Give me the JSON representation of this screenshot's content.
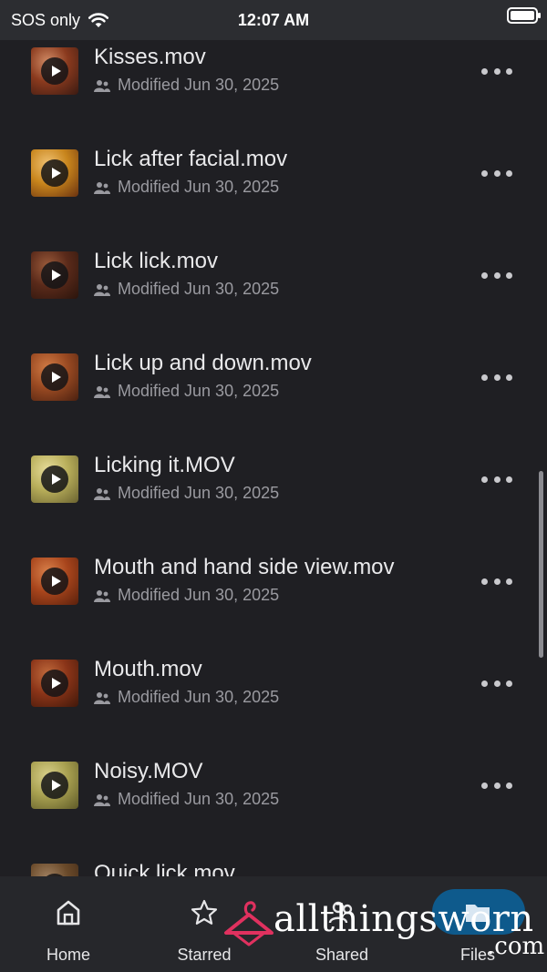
{
  "status_bar": {
    "carrier": "SOS only",
    "time": "12:07 AM",
    "icons": [
      "wifi-icon",
      "battery-icon"
    ]
  },
  "files": [
    {
      "name": "Kisses.mov",
      "modified": "Modified Jun 30, 2025",
      "thumb_colors": [
        "#8a3a1e",
        "#d08a64",
        "#3a1a12"
      ]
    },
    {
      "name": "Lick after facial.mov",
      "modified": "Modified Jun 30, 2025",
      "thumb_colors": [
        "#c8851c",
        "#efc070",
        "#6a3210"
      ]
    },
    {
      "name": "Lick lick.mov",
      "modified": "Modified Jun 30, 2025",
      "thumb_colors": [
        "#5a2a1a",
        "#9a5a3a",
        "#2a140c"
      ]
    },
    {
      "name": "Lick up and down.mov",
      "modified": "Modified Jun 30, 2025",
      "thumb_colors": [
        "#9a4a22",
        "#d07a44",
        "#4a2010"
      ]
    },
    {
      "name": "Licking it.MOV",
      "modified": "Modified Jun 30, 2025",
      "thumb_colors": [
        "#b8ae5a",
        "#e6dc9a",
        "#6a6230"
      ]
    },
    {
      "name": "Mouth and hand side view.mov",
      "modified": "Modified Jun 30, 2025",
      "thumb_colors": [
        "#a8451c",
        "#d8804a",
        "#5a200c"
      ]
    },
    {
      "name": "Mouth.mov",
      "modified": "Modified Jun 30, 2025",
      "thumb_colors": [
        "#8a3418",
        "#c06a3c",
        "#40180a"
      ]
    },
    {
      "name": "Noisy.MOV",
      "modified": "Modified Jun 30, 2025",
      "thumb_colors": [
        "#a8a050",
        "#d8d08a",
        "#5e5a28"
      ]
    },
    {
      "name": "Quick lick.mov",
      "modified": "",
      "thumb_colors": [
        "#6a4a2a",
        "#a08060",
        "#3a2414"
      ]
    }
  ],
  "bottom_nav": [
    {
      "label": "Home",
      "icon": "home-icon"
    },
    {
      "label": "Starred",
      "icon": "star-icon"
    },
    {
      "label": "Shared",
      "icon": "shared-icon"
    },
    {
      "label": "Files",
      "icon": "folder-icon",
      "selected": true
    }
  ],
  "watermark": {
    "text": "allthingsworn",
    "suffix": ".com",
    "logo": "hanger-logo"
  },
  "colors": {
    "background": "#1f1f23",
    "status_bar": "#2c2d31",
    "nav_bar": "#26272b",
    "accent": "#0e5a8c",
    "text_secondary": "#9a9aa0"
  }
}
